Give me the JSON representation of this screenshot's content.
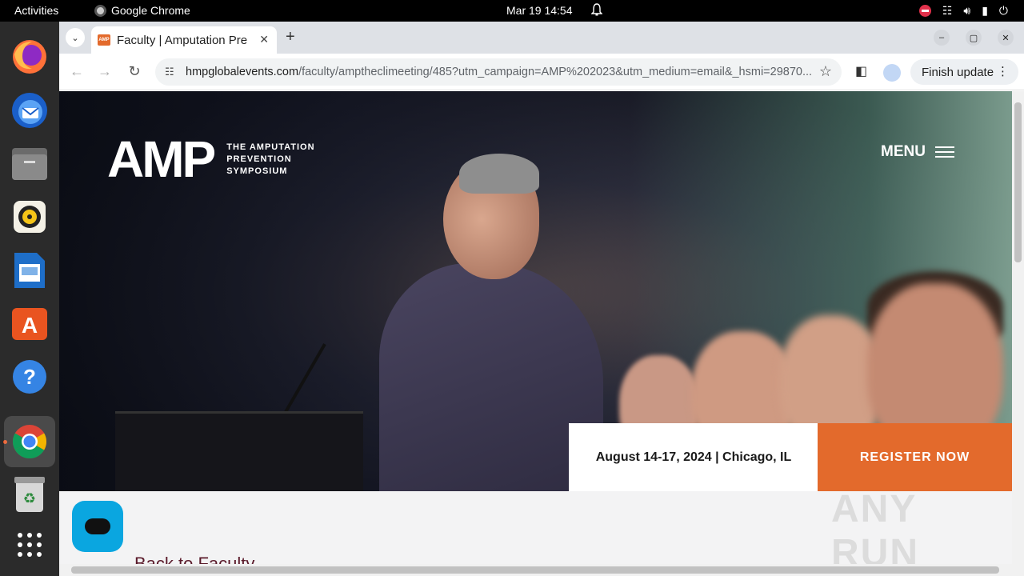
{
  "topbar": {
    "activities": "Activities",
    "app_name": "Google Chrome",
    "clock": "Mar 19  14:54"
  },
  "dock": {
    "items": [
      "firefox-icon",
      "thunderbird-icon",
      "files-icon",
      "rhythmbox-icon",
      "writer-icon",
      "app-center-icon",
      "help-icon",
      "chrome-icon",
      "trash-icon",
      "app-grid-icon"
    ]
  },
  "browser": {
    "tab_title": "Faculty | Amputation Pre",
    "favicon_text": "AMP",
    "url_host": "hmpglobalevents.com",
    "url_path": "/faculty/amptheclimeeting/485?utm_campaign=AMP%202023&utm_medium=email&_hsmi=29870...",
    "finish_update": "Finish update"
  },
  "page": {
    "logo_text": "AMP",
    "tagline_1": "THE AMPUTATION",
    "tagline_2": "PREVENTION",
    "tagline_3": "SYMPOSIUM",
    "menu_label": "MENU",
    "event_info": "August 14-17, 2024 | Chicago, IL",
    "register_label": "REGISTER NOW",
    "back_link": "Back to Faculty",
    "watermark": "ANY RUN"
  },
  "colors": {
    "accent_orange": "#e36a2c",
    "chat_blue": "#0aa6e0"
  }
}
